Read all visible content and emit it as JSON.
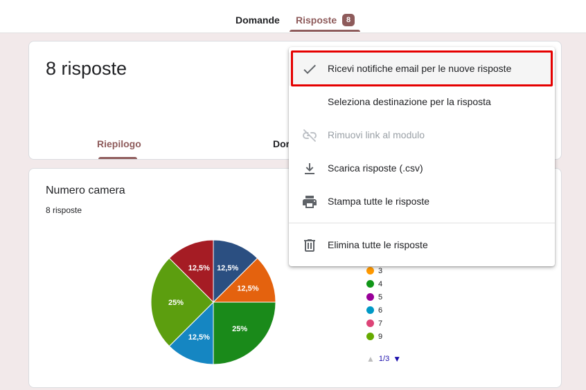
{
  "tabs": {
    "domande": "Domande",
    "risposte": "Risposte",
    "risposte_badge": "8"
  },
  "header": {
    "response_count": "8 risposte",
    "subtab_riepilogo": "Riepilogo",
    "subtab_domanda_partial": "Dor"
  },
  "question": {
    "title": "Numero camera",
    "subtitle": "8 risposte",
    "legend": [
      {
        "label": "3",
        "color": "#ff9900"
      },
      {
        "label": "4",
        "color": "#109618"
      },
      {
        "label": "5",
        "color": "#990099"
      },
      {
        "label": "6",
        "color": "#0099c6"
      },
      {
        "label": "7",
        "color": "#dd4477"
      },
      {
        "label": "9",
        "color": "#66aa00"
      }
    ],
    "pager": "1/3"
  },
  "chart_data": {
    "type": "pie",
    "slices": [
      {
        "label": "12,5%",
        "value": 12.5,
        "color": "#2b4f81"
      },
      {
        "label": "12,5%",
        "value": 12.5,
        "color": "#e4620e"
      },
      {
        "label": "25%",
        "value": 25,
        "color": "#1a8a1a"
      },
      {
        "label": "12,5%",
        "value": 12.5,
        "color": "#1586c2"
      },
      {
        "label": "25%",
        "value": 25,
        "color": "#5c9e0f"
      },
      {
        "label": "12,5%",
        "value": 12.5,
        "color": "#a51c24"
      }
    ]
  },
  "menu": {
    "items": [
      {
        "label": "Ricevi notifiche email per le nuove risposte",
        "icon": "check-icon",
        "disabled": false
      },
      {
        "label": "Seleziona destinazione per la risposta",
        "icon": "",
        "disabled": false
      },
      {
        "label": "Rimuovi link al modulo",
        "icon": "link-off-icon",
        "disabled": true
      },
      {
        "label": "Scarica risposte (.csv)",
        "icon": "download-icon",
        "disabled": false
      },
      {
        "label": "Stampa tutte le risposte",
        "icon": "print-icon",
        "disabled": false
      },
      {
        "label": "Elimina tutte le risposte",
        "icon": "trash-icon",
        "disabled": false
      }
    ]
  },
  "colors": {
    "accent": "#8e5b5b",
    "background": "#f2e9ea",
    "highlight": "#e50000"
  }
}
